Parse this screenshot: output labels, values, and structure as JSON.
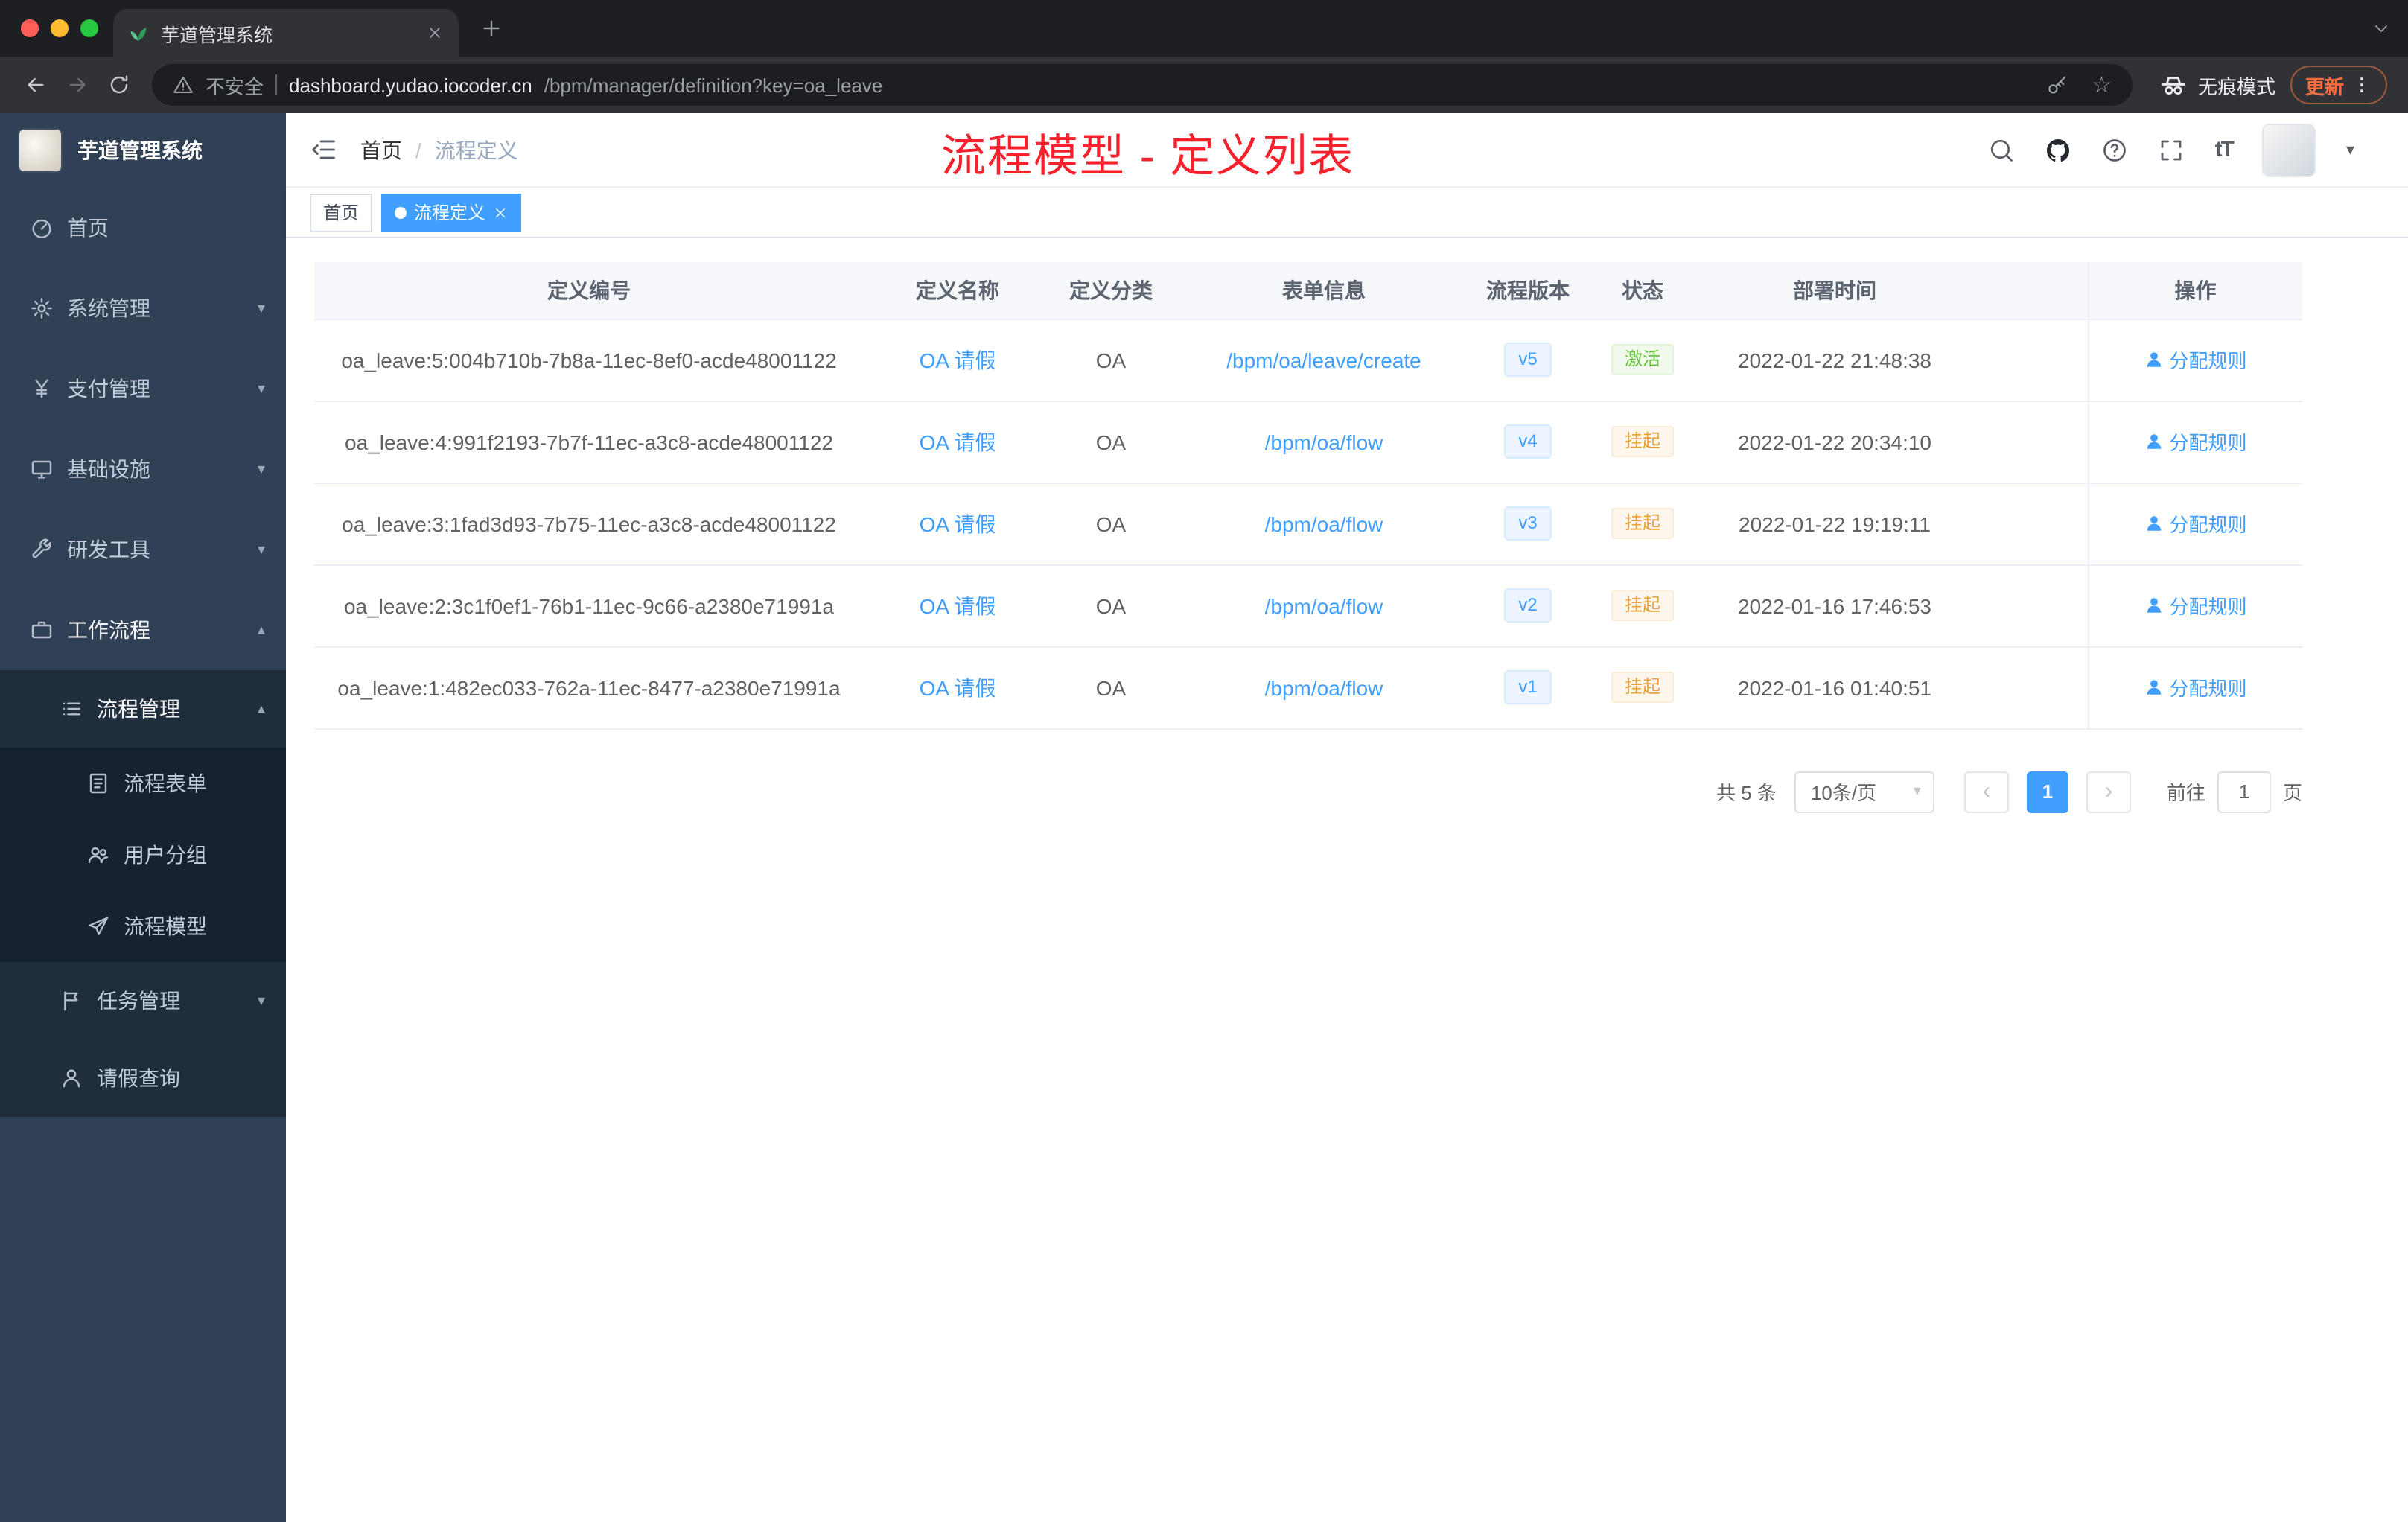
{
  "colors": {
    "accent": "#409eff",
    "success": "#67c23a",
    "warning": "#e6a23c",
    "annotation_red": "#f5222d",
    "sidebar_bg": "#304156"
  },
  "browser": {
    "tab_title": "芋道管理系统",
    "security_label": "不安全",
    "url_host": "dashboard.yudao.iocoder.cn",
    "url_path": "/bpm/manager/definition?key=oa_leave",
    "incognito_label": "无痕模式",
    "update_label": "更新"
  },
  "sidebar": {
    "logo_title": "芋道管理系统",
    "items": [
      {
        "key": "home",
        "label": "首页",
        "icon": "dashboard-icon",
        "level": 0
      },
      {
        "key": "system",
        "label": "系统管理",
        "icon": "gear-icon",
        "level": 0,
        "arrow": "down"
      },
      {
        "key": "payment",
        "label": "支付管理",
        "icon": "yen-icon",
        "level": 0,
        "arrow": "down"
      },
      {
        "key": "infrastructure",
        "label": "基础设施",
        "icon": "infra-icon",
        "level": 0,
        "arrow": "down"
      },
      {
        "key": "devtools",
        "label": "研发工具",
        "icon": "tools-icon",
        "level": 0,
        "arrow": "down"
      },
      {
        "key": "workflow",
        "label": "工作流程",
        "icon": "workflow-icon",
        "level": 0,
        "arrow": "up",
        "active": true
      },
      {
        "key": "process-manage",
        "label": "流程管理",
        "icon": "process-manage-icon",
        "level": 1,
        "arrow": "up",
        "active": true
      },
      {
        "key": "process-form",
        "label": "流程表单",
        "icon": "form-icon",
        "level": 2
      },
      {
        "key": "user-group",
        "label": "用户分组",
        "icon": "user-group-icon",
        "level": 2
      },
      {
        "key": "process-model",
        "label": "流程模型",
        "icon": "process-model-icon",
        "level": 2
      },
      {
        "key": "task-manage",
        "label": "任务管理",
        "icon": "task-icon",
        "level": 1,
        "arrow": "down"
      },
      {
        "key": "leave-query",
        "label": "请假查询",
        "icon": "leave-icon",
        "level": 1
      }
    ]
  },
  "header": {
    "breadcrumb_home": "首页",
    "breadcrumb_sep": "/",
    "breadcrumb_current": "流程定义",
    "annotation": "流程模型 - 定义列表"
  },
  "tags": [
    {
      "label": "首页",
      "active": false
    },
    {
      "label": "流程定义",
      "active": true
    }
  ],
  "table": {
    "columns": [
      "定义编号",
      "定义名称",
      "定义分类",
      "表单信息",
      "流程版本",
      "状态",
      "部署时间",
      "操作"
    ],
    "rows": [
      {
        "id": "oa_leave:5:004b710b-7b8a-11ec-8ef0-acde48001122",
        "name": "OA 请假",
        "category": "OA",
        "form": "/bpm/oa/leave/create",
        "version": "v5",
        "status": "激活",
        "status_type": "success",
        "deploy_time": "2022-01-22 21:48:38",
        "action": "分配规则"
      },
      {
        "id": "oa_leave:4:991f2193-7b7f-11ec-a3c8-acde48001122",
        "name": "OA 请假",
        "category": "OA",
        "form": "/bpm/oa/flow",
        "version": "v4",
        "status": "挂起",
        "status_type": "warning",
        "deploy_time": "2022-01-22 20:34:10",
        "action": "分配规则"
      },
      {
        "id": "oa_leave:3:1fad3d93-7b75-11ec-a3c8-acde48001122",
        "name": "OA 请假",
        "category": "OA",
        "form": "/bpm/oa/flow",
        "version": "v3",
        "status": "挂起",
        "status_type": "warning",
        "deploy_time": "2022-01-22 19:19:11",
        "action": "分配规则"
      },
      {
        "id": "oa_leave:2:3c1f0ef1-76b1-11ec-9c66-a2380e71991a",
        "name": "OA 请假",
        "category": "OA",
        "form": "/bpm/oa/flow",
        "version": "v2",
        "status": "挂起",
        "status_type": "warning",
        "deploy_time": "2022-01-16 17:46:53",
        "action": "分配规则"
      },
      {
        "id": "oa_leave:1:482ec033-762a-11ec-8477-a2380e71991a",
        "name": "OA 请假",
        "category": "OA",
        "form": "/bpm/oa/flow",
        "version": "v1",
        "status": "挂起",
        "status_type": "warning",
        "deploy_time": "2022-01-16 01:40:51",
        "action": "分配规则"
      }
    ]
  },
  "pagination": {
    "total": "共 5 条",
    "page_size": "10条/页",
    "current_page": "1",
    "goto": "前往",
    "page_unit": "页",
    "goto_value": "1"
  }
}
